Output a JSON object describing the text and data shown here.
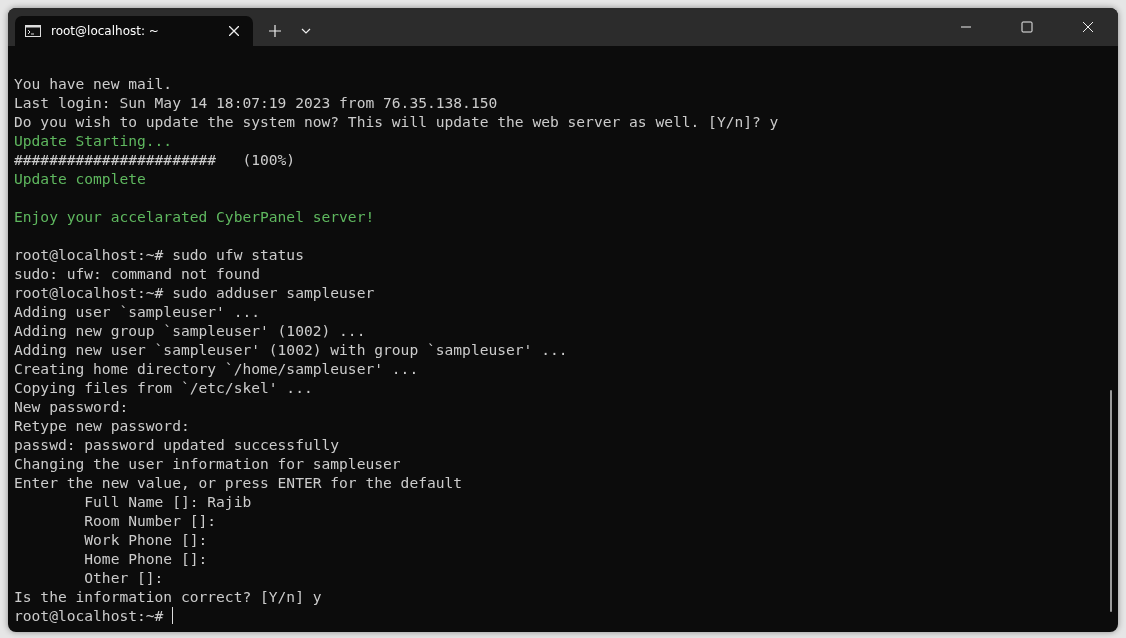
{
  "tabs": [
    {
      "title": "root@localhost: ~",
      "selected": true
    }
  ],
  "lines": [
    {
      "kind": "text",
      "text": "You have new mail."
    },
    {
      "kind": "text",
      "text": "Last login: Sun May 14 18:07:19 2023 from 76.35.138.150"
    },
    {
      "kind": "text",
      "text": "Do you wish to update the system now? This will update the web server as well. [Y/n]? y"
    },
    {
      "kind": "success",
      "text": "Update Starting..."
    },
    {
      "kind": "text",
      "text": "#######################   (100%)"
    },
    {
      "kind": "success",
      "text": "Update complete"
    },
    {
      "kind": "blank"
    },
    {
      "kind": "success",
      "text": "Enjoy your accelarated CyberPanel server!"
    },
    {
      "kind": "blank"
    },
    {
      "kind": "text",
      "text": "root@localhost:~# sudo ufw status"
    },
    {
      "kind": "text",
      "text": "sudo: ufw: command not found"
    },
    {
      "kind": "text",
      "text": "root@localhost:~# sudo adduser sampleuser"
    },
    {
      "kind": "text",
      "text": "Adding user `sampleuser' ..."
    },
    {
      "kind": "text",
      "text": "Adding new group `sampleuser' (1002) ..."
    },
    {
      "kind": "text",
      "text": "Adding new user `sampleuser' (1002) with group `sampleuser' ..."
    },
    {
      "kind": "text",
      "text": "Creating home directory `/home/sampleuser' ..."
    },
    {
      "kind": "text",
      "text": "Copying files from `/etc/skel' ..."
    },
    {
      "kind": "text",
      "text": "New password:"
    },
    {
      "kind": "text",
      "text": "Retype new password:"
    },
    {
      "kind": "text",
      "text": "passwd: password updated successfully"
    },
    {
      "kind": "text",
      "text": "Changing the user information for sampleuser"
    },
    {
      "kind": "text",
      "text": "Enter the new value, or press ENTER for the default"
    },
    {
      "kind": "text",
      "text": "        Full Name []: Rajib"
    },
    {
      "kind": "text",
      "text": "        Room Number []:"
    },
    {
      "kind": "text",
      "text": "        Work Phone []:"
    },
    {
      "kind": "text",
      "text": "        Home Phone []:"
    },
    {
      "kind": "text",
      "text": "        Other []:"
    },
    {
      "kind": "text",
      "text": "Is the information correct? [Y/n] y"
    },
    {
      "kind": "prompt",
      "text": "root@localhost:~#"
    }
  ]
}
